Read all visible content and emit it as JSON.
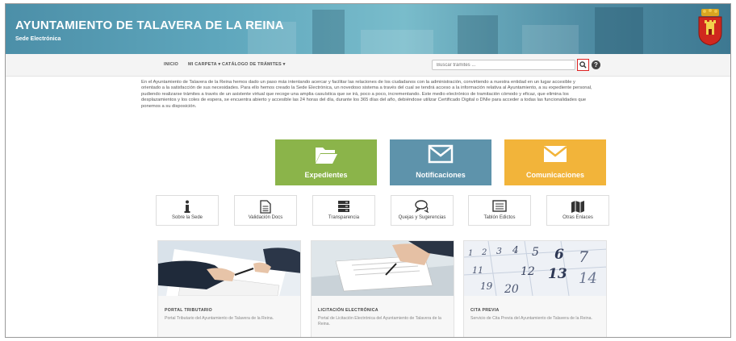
{
  "header": {
    "title": "AYUNTAMIENTO DE TALAVERA DE LA REINA",
    "subtitle": "Sede Electrónica"
  },
  "nav": {
    "items": [
      "INICIO",
      "MI CARPETA ▾",
      "CATÁLOGO DE TRÁMITES ▾"
    ],
    "search_placeholder": "Buscar trámites ...",
    "help_label": "?"
  },
  "intro": "En el Ayuntamiento de Talavera de la Reina hemos dado un paso más intentando acercar y facilitar las relaciones de los ciudadanos con la administración, convirtiendo a nuestra entidad en un lugar accesible y orientado a la satisfacción de sus necesidades. Para ello hemos creado la Sede Electrónica, un novedoso sistema a través del cual se tendrá acceso a la información relativa al Ayuntamiento, a su expediente personal, pudiendo realizarse trámites a través de un asistente virtual que recoge una amplia casuística que se irá, poco a poco, incrementando. Este medio electrónico de tramitación cómodo y eficaz, que elimina los desplazamientos y los coles de espera, se encuentra abierto y accesible las 24 horas del día, durante los 365 días del año, debiéndose utilizar Certificado Digital o DNIe para acceder a todas las funcionalidades que ponemos a su disposición.",
  "main_tiles": [
    {
      "label": "Expedientes",
      "icon": "folder-open-icon",
      "color": "#8bb44a"
    },
    {
      "label": "Notificaciones",
      "icon": "envelope-icon",
      "color": "#5e93ab"
    },
    {
      "label": "Comunicaciones",
      "icon": "envelope-icon",
      "color": "#f2b43a"
    }
  ],
  "small_tiles": [
    {
      "label": "Sobre la Sede",
      "icon": "info-icon"
    },
    {
      "label": "Validación Docs",
      "icon": "document-icon"
    },
    {
      "label": "Transparencia",
      "icon": "server-icon"
    },
    {
      "label": "Quejas y Sugerencias",
      "icon": "chat-icon"
    },
    {
      "label": "Tablón Edictos",
      "icon": "list-box-icon"
    },
    {
      "label": "Otras Enlaces",
      "icon": "map-icon"
    }
  ],
  "cards": [
    {
      "title": "PORTAL TRIBUTARIO",
      "desc": "Portal Tributario del Ayuntamiento de Talavera de la Reina."
    },
    {
      "title": "LICITACIÓN ELECTRÓNICA",
      "desc": "Portal de Licitación Electrónica del Ayuntamiento de Talavera de la Reina."
    },
    {
      "title": "CITA PREVIA",
      "desc": "Servicio de Cita Previa del Ayuntamiento de Talavera de la Reina."
    }
  ],
  "calendar_numbers": [
    "1",
    "2",
    "3",
    "4",
    "5",
    "6",
    "7",
    "11",
    "12",
    "13",
    "14",
    "19",
    "20"
  ]
}
